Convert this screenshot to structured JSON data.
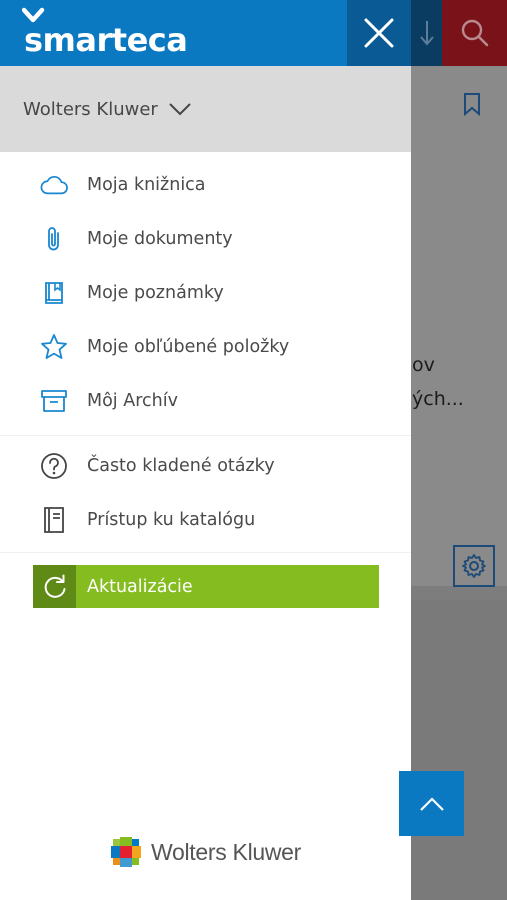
{
  "app": {
    "logo_text": "smarteca",
    "close_icon": "close-icon"
  },
  "background": {
    "text_line1": "ov",
    "text_line2": "ých..."
  },
  "org": {
    "label": "Wolters Kluwer"
  },
  "menu_primary": [
    {
      "label": "Moja knižnica",
      "icon": "cloud-icon"
    },
    {
      "label": "Moje dokumenty",
      "icon": "paperclip-icon"
    },
    {
      "label": "Moje poznámky",
      "icon": "notebook-icon"
    },
    {
      "label": "Moje obľúbené položky",
      "icon": "star-icon"
    },
    {
      "label": "Môj Archív",
      "icon": "archive-icon"
    }
  ],
  "menu_secondary": [
    {
      "label": "Často kladené otázky",
      "icon": "help-icon"
    },
    {
      "label": "Prístup ku katalógu",
      "icon": "catalog-icon"
    }
  ],
  "update": {
    "label": "Aktualizácie",
    "icon": "refresh-icon"
  },
  "brand": {
    "name": "Wolters Kluwer"
  },
  "colors": {
    "primary_blue": "#0b78c2",
    "accent_green": "#85bc20",
    "icon_blue": "#1a87d0"
  }
}
